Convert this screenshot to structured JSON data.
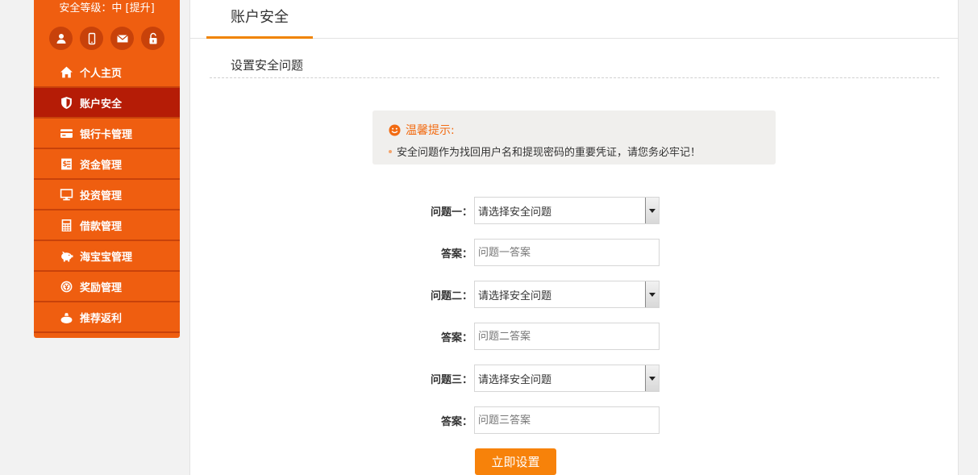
{
  "sidebar": {
    "security_level_text": "安全等级：中",
    "upgrade_label": "[提升]",
    "nav_items": [
      {
        "label": "个人主页"
      },
      {
        "label": "账户安全"
      },
      {
        "label": "银行卡管理"
      },
      {
        "label": "资金管理"
      },
      {
        "label": "投资管理"
      },
      {
        "label": "借款管理"
      },
      {
        "label": "海宝宝管理"
      },
      {
        "label": "奖励管理"
      },
      {
        "label": "推荐返利"
      }
    ]
  },
  "main": {
    "tab_label": "账户安全",
    "section_title": "设置安全问题",
    "tip": {
      "title": "温馨提示:",
      "text": "安全问题作为找回用户名和提现密码的重要凭证，请您务必牢记！"
    },
    "form": {
      "q1_label": "问题一：",
      "q1_selected": "请选择安全问题",
      "a1_label": "答案：",
      "a1_placeholder": "问题一答案",
      "q2_label": "问题二：",
      "q2_selected": "请选择安全问题",
      "a2_label": "答案：",
      "a2_placeholder": "问题二答案",
      "q3_label": "问题三：",
      "q3_selected": "请选择安全问题",
      "a3_label": "答案：",
      "a3_placeholder": "问题三答案",
      "submit_label": "立即设置"
    }
  },
  "colors": {
    "sidebar_bg": "#ef5e10",
    "sidebar_active": "#b51c06",
    "accent": "#f7820a",
    "tip_title": "#f26b12"
  }
}
